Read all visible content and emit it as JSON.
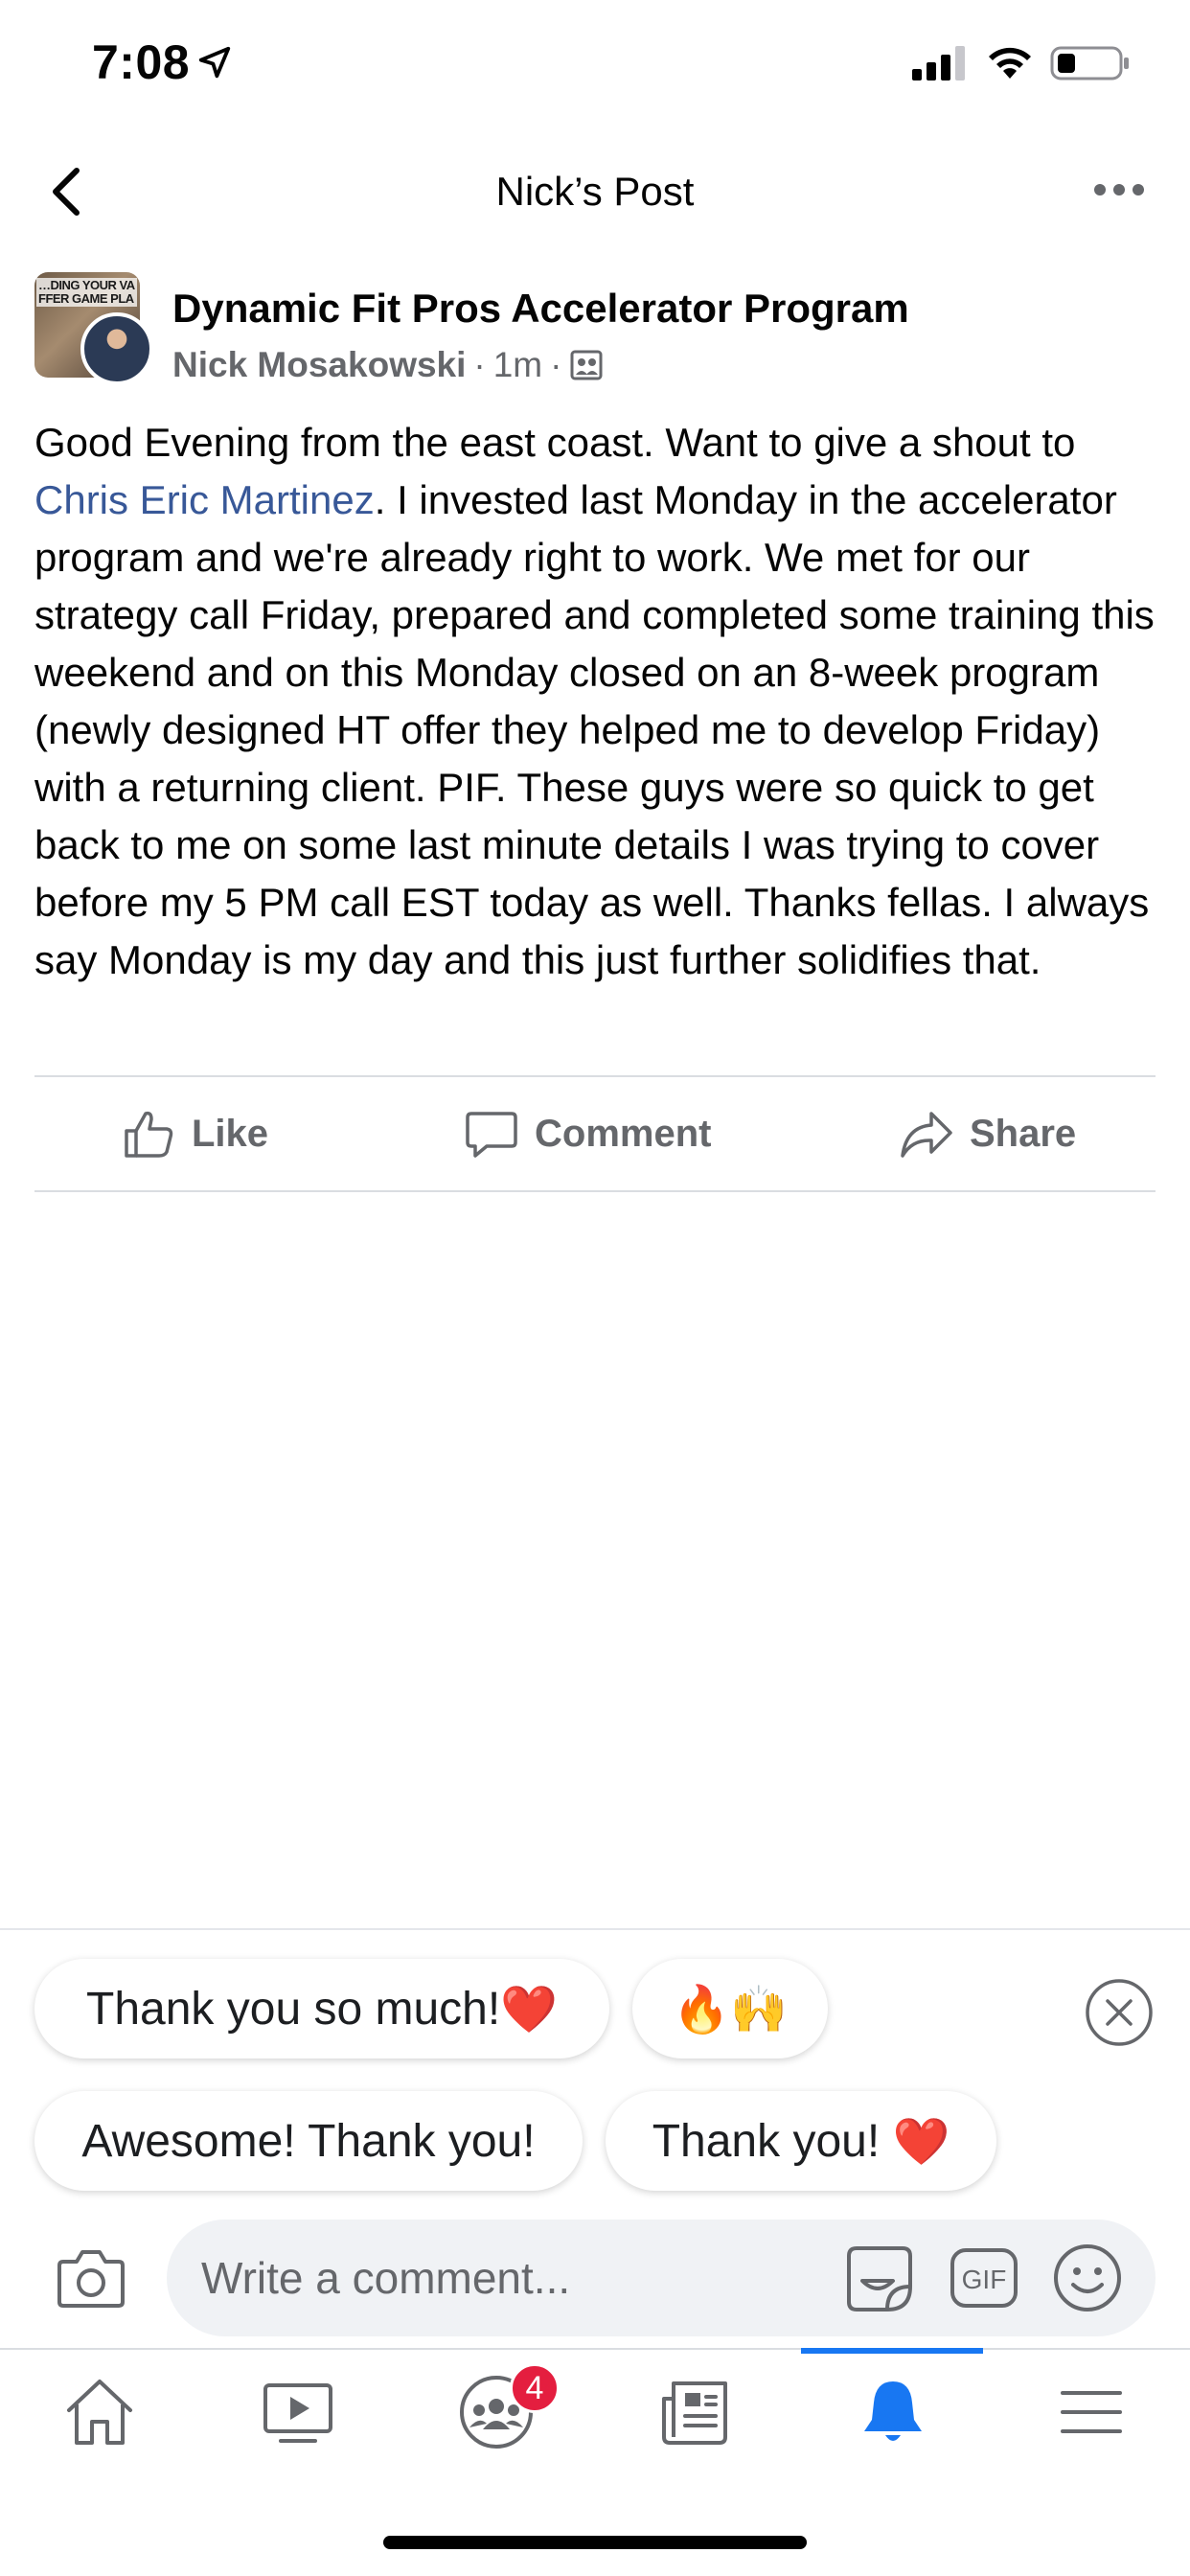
{
  "status_bar": {
    "time": "7:08"
  },
  "header": {
    "title": "Nick’s Post"
  },
  "post": {
    "group_name": "Dynamic Fit Pros Accelerator Program",
    "group_avatar_text": "…DING YOUR VA FFER GAME PLA",
    "author": "Nick Mosakowski",
    "time": "1m",
    "separator": "·",
    "body_before_mention": "Good Evening from the east coast. Want to give a shout to ",
    "mention": "Chris Eric Martinez",
    "body_after_mention": ". I invested last Monday in the accelerator program and we're already right to work. We met for our strategy call Friday, prepared and completed some training this weekend and on this Monday closed on an 8-week program (newly designed HT offer they helped me to develop Friday) with a returning client. PIF. These guys were so quick to get back to me on some last minute details I was trying to cover before my 5 PM call EST today as well. Thanks fellas. I always say Monday is my day and this just further solidifies that."
  },
  "actions": {
    "like": "Like",
    "comment": "Comment",
    "share": "Share"
  },
  "quick_replies": [
    {
      "text": "Thank you so much!",
      "emoji": "❤️"
    },
    {
      "text": "",
      "emoji": "🔥🙌"
    },
    {
      "text": "Awesome! Thank you!",
      "emoji": ""
    },
    {
      "text": "Thank you! ",
      "emoji": "❤️"
    }
  ],
  "composer": {
    "placeholder": "Write a comment..."
  },
  "tab_bar": {
    "tabs": [
      "home",
      "watch",
      "groups",
      "news",
      "notifications",
      "menu"
    ],
    "active": "notifications",
    "groups_badge": "4"
  },
  "colors": {
    "accent": "#1877f2",
    "mention": "#385898",
    "secondary_text": "#65676b",
    "badge": "#e41e3f"
  }
}
